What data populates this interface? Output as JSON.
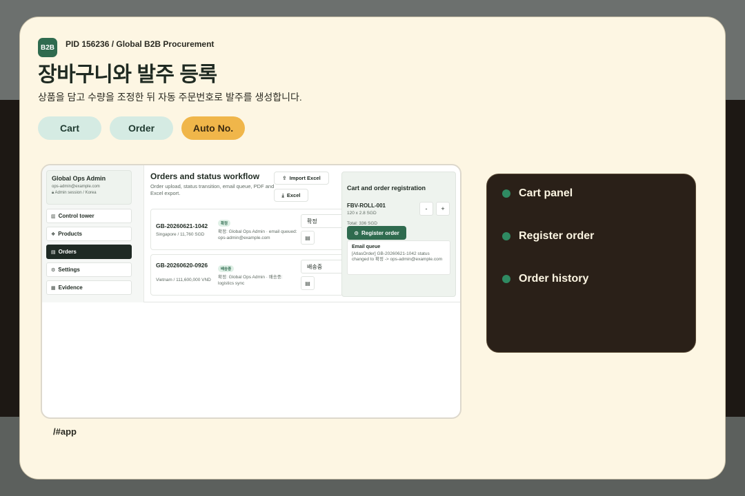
{
  "header": {
    "badge": "B2B",
    "pid": "PID 156236 / Global B2B Procurement",
    "title": "장바구니와 발주 등록",
    "subtitle": "상품을 담고 수량을 조정한 뒤 자동 주문번호로 발주를 생성합니다."
  },
  "pills": [
    "Cart",
    "Order",
    "Auto No."
  ],
  "colors": {
    "accent_green": "#2f6b4f",
    "pill_highlight": "#f0b64a",
    "pill_default": "#d5ebe3",
    "info_panel_bg": "#2a2018",
    "card_bg": "#fdf6e3"
  },
  "app": {
    "sidebar": {
      "admin_name": "Global Ops Admin",
      "admin_email": "ops-admin@example.com",
      "admin_session": "Admin session / Korea",
      "nav": [
        {
          "label": "Control tower",
          "icon": "chart-icon",
          "glyph": "▥",
          "active": false
        },
        {
          "label": "Products",
          "icon": "boxes-icon",
          "glyph": "❖",
          "active": false
        },
        {
          "label": "Orders",
          "icon": "clipboard-icon",
          "glyph": "▤",
          "active": true
        },
        {
          "label": "Settings",
          "icon": "user-gear-icon",
          "glyph": "⚙",
          "active": false
        },
        {
          "label": "Evidence",
          "icon": "document-icon",
          "glyph": "▦",
          "active": false
        }
      ]
    },
    "orders": {
      "title": "Orders and status workflow",
      "description": "Order upload, status transition, email queue, PDF and Excel export.",
      "import_excel_label": "Import Excel",
      "excel_label": "Excel",
      "rows": [
        {
          "id": "GB-20260621-1042",
          "location": "Singapore / 11,760 SGD",
          "tag": "확정",
          "note": "확정: Global Ops Admin · email queued: ops-admin@example.com",
          "status": "확정"
        },
        {
          "id": "GB-20260620-0926",
          "location": "Vietnam / 111,600,000 VND",
          "tag": "배송중",
          "note": "확정: Global Ops Admin · 배송중: logistics sync",
          "status": "배송중"
        }
      ]
    },
    "cart": {
      "title": "Cart and order registration",
      "sku": "FBV-ROLL-001",
      "sku_detail": "120 x 2.8 SGD",
      "minus_label": "-",
      "plus_label": "+",
      "total": "Total: 336 SGD",
      "register_label": "Register order",
      "email_queue_title": "Email queue",
      "email_queue_text": "[AtlasOrder] GB-20260621-1042 status changed to 확정 -> ops-admin@example.com"
    }
  },
  "path": "/#app",
  "info_items": [
    "Cart panel",
    "Register order",
    "Order history"
  ]
}
